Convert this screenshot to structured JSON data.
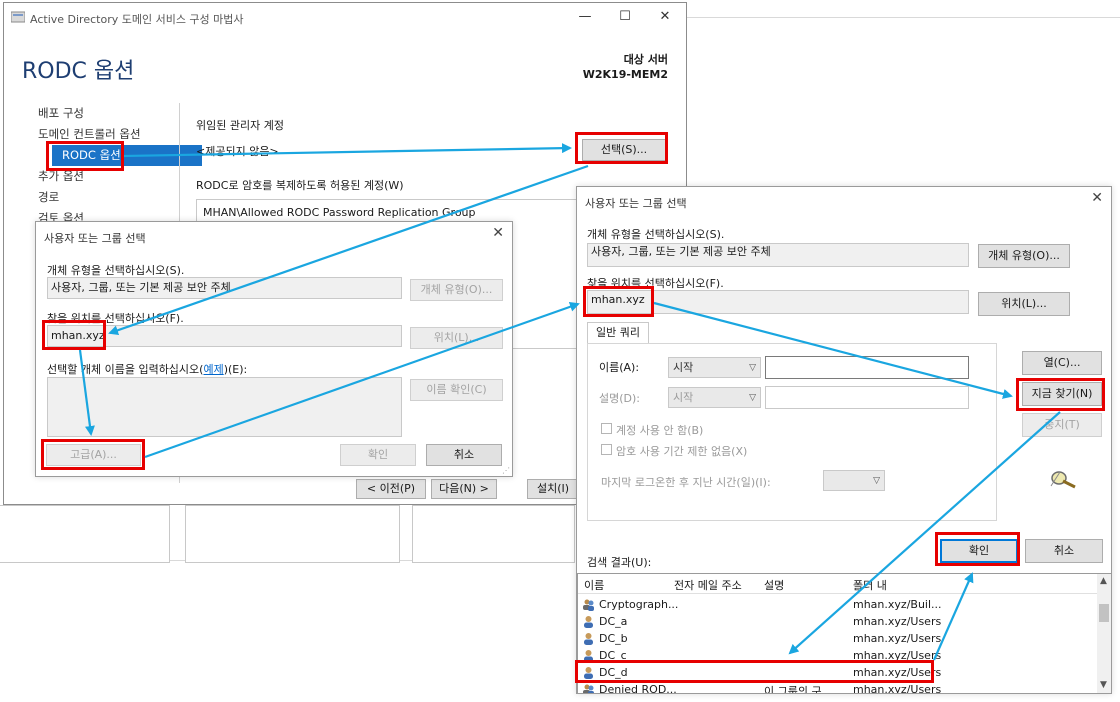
{
  "wizard": {
    "title": "Active Directory 도메인 서비스 구성 마법사",
    "heading": "RODC 옵션",
    "target_label": "대상 서버",
    "target_name": "W2K19-MEM2",
    "nav": [
      "배포 구성",
      "도메인 컨트롤러 옵션",
      "RODC 옵션",
      "추가 옵션",
      "경로",
      "검토 옵션"
    ],
    "delegated_admin_label": "위임된 관리자 계정",
    "delegated_admin_value": "<제공되지 않음>",
    "select_button": "선택(S)...",
    "allowed_label": "RODC로 암호를 복제하도록 허용된 계정(W)",
    "allowed_value": "MHAN\\Allowed RODC Password Replication Group",
    "prev_button": "< 이전(P)",
    "next_button": "다음(N) >",
    "install_button": "설치(I)"
  },
  "dialog_small": {
    "title": "사용자 또는 그룹 선택",
    "object_type_label": "개체 유형을 선택하십시오(S).",
    "object_type_value": "사용자, 그룹, 또는 기본 제공 보안 주체",
    "object_type_button": "개체 유형(O)...",
    "location_label": "찾을 위치를 선택하십시오(F).",
    "location_value": "mhan.xyz",
    "location_button": "위치(L)...",
    "enter_names_label_pre": "선택할 개체 이름을 입력하십시오(",
    "enter_names_link": "예제",
    "enter_names_label_post": ")(E):",
    "check_names_button": "이름 확인(C)",
    "advanced_button": "고급(A)...",
    "ok_button": "확인",
    "cancel_button": "취소"
  },
  "dialog_large": {
    "title": "사용자 또는 그룹 선택",
    "object_type_label": "개체 유형을 선택하십시오(S).",
    "object_type_value": "사용자, 그룹, 또는 기본 제공 보안 주체",
    "object_type_button": "개체 유형(O)...",
    "location_label": "찾을 위치를 선택하십시오(F).",
    "location_value": "mhan.xyz",
    "location_button": "위치(L)...",
    "tab_label": "일반 쿼리",
    "name_label": "이름(A):",
    "name_mode": "시작",
    "desc_label": "설명(D):",
    "desc_mode": "시작",
    "disabled_accounts": "계정 사용 안 함(B)",
    "non_expiring": "암호 사용 기간 제한 없음(X)",
    "days_since_logon": "마지막 로그온한 후 지난 시간(일)(I):",
    "columns_button": "열(C)...",
    "find_now_button": "지금 찾기(N)",
    "stop_button": "중지(T)",
    "results_label": "검색 결과(U):",
    "ok_button": "확인",
    "cancel_button": "취소",
    "columns": [
      "이름",
      "전자 메일 주소",
      "설명",
      "폴더 내"
    ],
    "rows": [
      {
        "name": "Cryptograph...",
        "email": "",
        "desc": "",
        "folder": "mhan.xyz/Buil..."
      },
      {
        "name": "DC_a",
        "email": "",
        "desc": "",
        "folder": "mhan.xyz/Users"
      },
      {
        "name": "DC_b",
        "email": "",
        "desc": "",
        "folder": "mhan.xyz/Users"
      },
      {
        "name": "DC_c",
        "email": "",
        "desc": "",
        "folder": "mhan.xyz/Users"
      },
      {
        "name": "DC_d",
        "email": "",
        "desc": "",
        "folder": "mhan.xyz/Users"
      },
      {
        "name": "Denied ROD...",
        "email": "",
        "desc": "이 그룹의 구...",
        "folder": "mhan.xyz/Users"
      }
    ]
  },
  "colors": {
    "accent": "#1a73c7",
    "highlight": "#e60000",
    "arrow": "#1aa6e0"
  }
}
